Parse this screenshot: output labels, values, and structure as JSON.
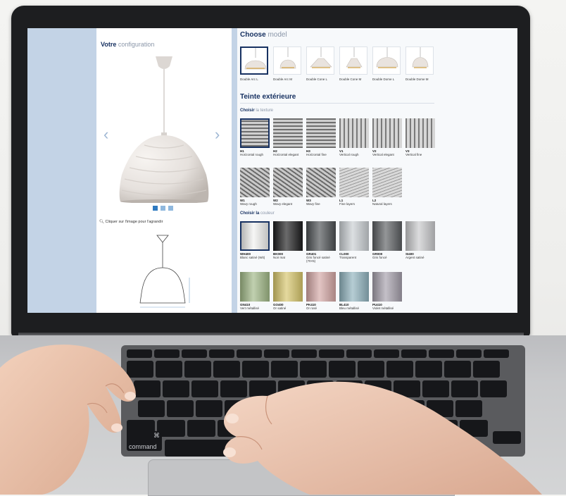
{
  "config": {
    "title_bold": "Votre",
    "title_light": "configuration",
    "zoom_hint": "Cliquer sur l'image pour l'agrandir"
  },
  "models": {
    "title_bold": "Choose",
    "title_light": "model",
    "items": [
      "Double Arc L",
      "Double Arc M",
      "Double Cone L",
      "Double Cone M",
      "Double Dome L",
      "Double Dome M"
    ]
  },
  "exterior": {
    "title": "Teinte extérieure",
    "texture_heading_bold": "Choisir",
    "texture_heading_light": "la texture",
    "textures": [
      {
        "code": "H1",
        "name": "Horizontal rough"
      },
      {
        "code": "H2",
        "name": "Horizontal elegant"
      },
      {
        "code": "H3",
        "name": "Horizontal fine"
      },
      {
        "code": "V1",
        "name": "Vertical rough"
      },
      {
        "code": "V2",
        "name": "Vertical elegant"
      },
      {
        "code": "V3",
        "name": "Vertical fine"
      },
      {
        "code": "W1",
        "name": "Wavy rough"
      },
      {
        "code": "W2",
        "name": "Wavy elegant"
      },
      {
        "code": "W3",
        "name": "Wavy fine"
      },
      {
        "code": "L1",
        "name": "Fine layers"
      },
      {
        "code": "L2",
        "name": "Natural layers"
      }
    ],
    "color_heading_bold": "Choisir la",
    "color_heading_light": "couleur",
    "colors": [
      {
        "code": "WH400",
        "name": "Blanc satiné (Wit)",
        "hex": "#f2f2f0"
      },
      {
        "code": "BK000",
        "name": "Noir mat",
        "hex": "#1b1b1c"
      },
      {
        "code": "GR401",
        "name": "Gris foncé satiné (70×5)",
        "hex": "#4b4f52"
      },
      {
        "code": "CL000",
        "name": "Transparent",
        "hex": "#c9ced2"
      },
      {
        "code": "GR000",
        "name": "Gris foncé",
        "hex": "#5a5d60"
      },
      {
        "code": "SI400",
        "name": "Argent satiné",
        "hex": "#c8c9cb"
      },
      {
        "code": "GN410",
        "name": "Vert métallisé",
        "hex": "#9fb785"
      },
      {
        "code": "GO400",
        "name": "Or satiné",
        "hex": "#d6c56a"
      },
      {
        "code": "PK410",
        "name": "Or rosé",
        "hex": "#d3a6a4"
      },
      {
        "code": "BL410",
        "name": "Bleu métallisé",
        "hex": "#8fb2bd"
      },
      {
        "code": "PU410",
        "name": "Violet métallisé",
        "hex": "#a49eaa"
      }
    ]
  },
  "keyboard": {
    "command_label": "command",
    "command_symbol": "⌘"
  },
  "colors": {
    "navy": "#173161",
    "screen_bg": "#c3d3e6",
    "dot_active": "#2f7ac0",
    "dot_inactive": "#8fb8de"
  }
}
